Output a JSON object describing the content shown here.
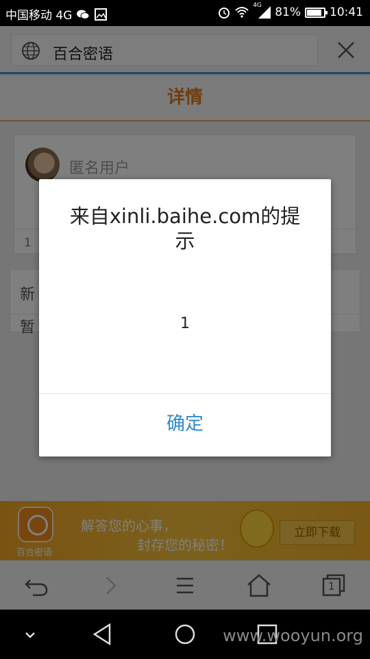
{
  "status_bar": {
    "carrier": "中国移动 4G",
    "network_badge": "4G",
    "battery": "81%",
    "battery_level": 0.81,
    "time": "10:41",
    "icons": [
      "wechat-icon",
      "image-icon",
      "alarm-icon",
      "wifi-icon",
      "signal-icon",
      "battery-icon"
    ]
  },
  "browser": {
    "page_title": "百合密语",
    "icons": [
      "globe-icon",
      "close-icon"
    ]
  },
  "page": {
    "header_title": "详情",
    "card": {
      "username": "匿名用户",
      "footer_text": "1"
    },
    "section": {
      "row1_text": "新",
      "row2_text": "暂"
    }
  },
  "banner": {
    "logo_label": "百合密语",
    "line1": "解答您的心事，",
    "line2": "封存您的秘密！",
    "download_button": "立即下载"
  },
  "dialog": {
    "title": "来自xinli.baihe.com的提示",
    "message": "1",
    "ok_label": "确定"
  },
  "toolbar": {
    "icons": [
      "back-icon",
      "forward-icon",
      "menu-icon",
      "home-icon",
      "tabs-icon"
    ],
    "tab_count": "1"
  },
  "nav_bar": {
    "icons": [
      "collapse-icon",
      "nav-back-icon",
      "nav-home-icon",
      "nav-recents-icon"
    ]
  },
  "watermark": "www.wooyun.org",
  "colors": {
    "accent_blue": "#2f8ad3",
    "header_orange": "#e07a1f",
    "banner_orange": "#f5a623"
  }
}
